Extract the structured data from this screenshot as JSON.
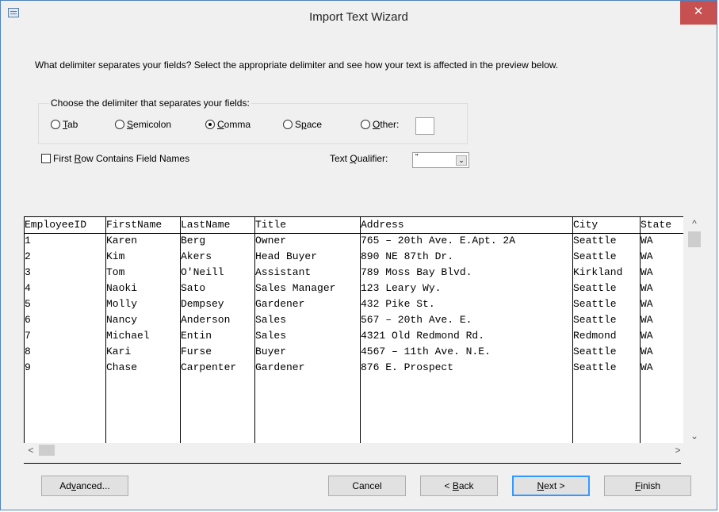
{
  "window": {
    "title": "Import Text Wizard",
    "close_glyph": "✕"
  },
  "question": "What delimiter separates your fields? Select the appropriate delimiter and see how your text is affected in the preview below.",
  "delimiter_group": {
    "caption": "Choose the delimiter that separates your fields:",
    "options": [
      {
        "pre": "",
        "key": "T",
        "post": "ab",
        "checked": false
      },
      {
        "pre": "",
        "key": "S",
        "post": "emicolon",
        "checked": false
      },
      {
        "pre": "",
        "key": "C",
        "post": "omma",
        "checked": true
      },
      {
        "pre": "S",
        "key": "p",
        "post": "ace",
        "checked": false
      },
      {
        "pre": "",
        "key": "O",
        "post": "ther:",
        "checked": false
      }
    ],
    "other_value": ""
  },
  "first_row": {
    "pre": "First ",
    "key": "R",
    "post": "ow Contains Field Names",
    "checked": false
  },
  "text_qualifier": {
    "pre": "Text ",
    "key": "Q",
    "post": "ualifier:",
    "value": "\""
  },
  "preview": {
    "columns": [
      {
        "header": "EmployeeID",
        "cells": [
          "1",
          "2",
          "3",
          "4",
          "5",
          "6",
          "7",
          "8",
          "9"
        ]
      },
      {
        "header": "FirstName",
        "cells": [
          "Karen",
          "Kim",
          "Tom",
          "Naoki",
          "Molly",
          "Nancy",
          "Michael",
          "Kari",
          "Chase"
        ]
      },
      {
        "header": "LastName",
        "cells": [
          "Berg",
          "Akers",
          "O'Neill",
          "Sato",
          "Dempsey",
          "Anderson",
          "Entin",
          "Furse",
          "Carpenter"
        ]
      },
      {
        "header": "Title",
        "cells": [
          "Owner",
          "Head Buyer",
          "Assistant",
          "Sales Manager",
          "Gardener",
          "Sales",
          "Sales",
          "Buyer",
          "Gardener"
        ]
      },
      {
        "header": "Address",
        "cells": [
          "765 – 20th Ave. E.Apt. 2A",
          "890 NE 87th Dr.",
          "789 Moss Bay Blvd.",
          "123 Leary Wy.",
          "432 Pike St.",
          "567 – 20th Ave. E.",
          "4321 Old Redmond Rd.",
          "4567 – 11th Ave. N.E.",
          "876 E. Prospect"
        ]
      },
      {
        "header": "City",
        "cells": [
          "Seattle",
          "Seattle",
          "Kirkland",
          "Seattle",
          "Seattle",
          "Seattle",
          "Redmond",
          "Seattle",
          "Seattle"
        ]
      },
      {
        "header": "State",
        "cells": [
          "WA",
          "WA",
          "WA",
          "WA",
          "WA",
          "WA",
          "WA",
          "WA",
          "WA"
        ]
      }
    ]
  },
  "scroll": {
    "up": "^",
    "down": "⌄",
    "left": "<",
    "right": ">"
  },
  "buttons": {
    "advanced": {
      "pre": "Ad",
      "key": "v",
      "post": "anced..."
    },
    "cancel": {
      "pre": "Cancel",
      "key": "",
      "post": ""
    },
    "back": {
      "pre": "< ",
      "key": "B",
      "post": "ack"
    },
    "next": {
      "pre": "",
      "key": "N",
      "post": "ext >"
    },
    "finish": {
      "pre": "",
      "key": "F",
      "post": "inish"
    }
  }
}
